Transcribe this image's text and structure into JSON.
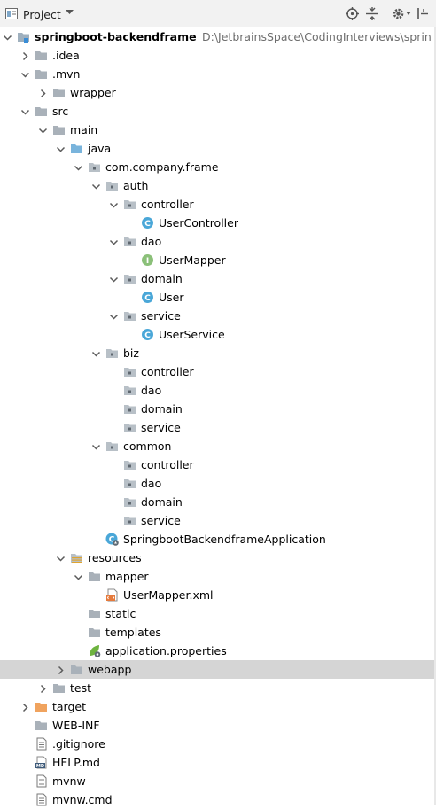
{
  "toolbar": {
    "title": "Project",
    "icons": [
      "project-view-icon",
      "dropdown-arrow-icon",
      "locate-icon",
      "collapse-all-icon",
      "gear-icon",
      "hide-panel-icon"
    ]
  },
  "tree": [
    {
      "label": "springboot-backendframe",
      "depth": 0,
      "state": "open",
      "icon": "module",
      "bold": true,
      "path": "D:\\JetbrainsSpace\\CodingInterviews\\springboot-b"
    },
    {
      "label": ".idea",
      "depth": 1,
      "state": "closed",
      "icon": "folder"
    },
    {
      "label": ".mvn",
      "depth": 1,
      "state": "open",
      "icon": "folder"
    },
    {
      "label": "wrapper",
      "depth": 2,
      "state": "closed",
      "icon": "folder"
    },
    {
      "label": "src",
      "depth": 1,
      "state": "open",
      "icon": "folder"
    },
    {
      "label": "main",
      "depth": 2,
      "state": "open",
      "icon": "folder"
    },
    {
      "label": "java",
      "depth": 3,
      "state": "open",
      "icon": "source-folder"
    },
    {
      "label": "com.company.frame",
      "depth": 4,
      "state": "open",
      "icon": "package"
    },
    {
      "label": "auth",
      "depth": 5,
      "state": "open",
      "icon": "package"
    },
    {
      "label": "controller",
      "depth": 6,
      "state": "open",
      "icon": "package"
    },
    {
      "label": "UserController",
      "depth": 7,
      "state": "leaf",
      "icon": "class"
    },
    {
      "label": "dao",
      "depth": 6,
      "state": "open",
      "icon": "package"
    },
    {
      "label": "UserMapper",
      "depth": 7,
      "state": "leaf",
      "icon": "interface"
    },
    {
      "label": "domain",
      "depth": 6,
      "state": "open",
      "icon": "package"
    },
    {
      "label": "User",
      "depth": 7,
      "state": "leaf",
      "icon": "class"
    },
    {
      "label": "service",
      "depth": 6,
      "state": "open",
      "icon": "package"
    },
    {
      "label": "UserService",
      "depth": 7,
      "state": "leaf",
      "icon": "class"
    },
    {
      "label": "biz",
      "depth": 5,
      "state": "open",
      "icon": "package"
    },
    {
      "label": "controller",
      "depth": 6,
      "state": "leaf",
      "icon": "package"
    },
    {
      "label": "dao",
      "depth": 6,
      "state": "leaf",
      "icon": "package"
    },
    {
      "label": "domain",
      "depth": 6,
      "state": "leaf",
      "icon": "package"
    },
    {
      "label": "service",
      "depth": 6,
      "state": "leaf",
      "icon": "package"
    },
    {
      "label": "common",
      "depth": 5,
      "state": "open",
      "icon": "package"
    },
    {
      "label": "controller",
      "depth": 6,
      "state": "leaf",
      "icon": "package"
    },
    {
      "label": "dao",
      "depth": 6,
      "state": "leaf",
      "icon": "package"
    },
    {
      "label": "domain",
      "depth": 6,
      "state": "leaf",
      "icon": "package"
    },
    {
      "label": "service",
      "depth": 6,
      "state": "leaf",
      "icon": "package"
    },
    {
      "label": "SpringbootBackendframeApplication",
      "depth": 5,
      "state": "leaf",
      "icon": "spring-app"
    },
    {
      "label": "resources",
      "depth": 3,
      "state": "open",
      "icon": "resources-folder"
    },
    {
      "label": "mapper",
      "depth": 4,
      "state": "open",
      "icon": "folder"
    },
    {
      "label": "UserMapper.xml",
      "depth": 5,
      "state": "leaf",
      "icon": "xml-file"
    },
    {
      "label": "static",
      "depth": 4,
      "state": "leaf",
      "icon": "folder"
    },
    {
      "label": "templates",
      "depth": 4,
      "state": "leaf",
      "icon": "folder"
    },
    {
      "label": "application.properties",
      "depth": 4,
      "state": "leaf",
      "icon": "spring-properties"
    },
    {
      "label": "webapp",
      "depth": 3,
      "state": "closed",
      "icon": "folder",
      "selected": true
    },
    {
      "label": "test",
      "depth": 2,
      "state": "closed",
      "icon": "folder"
    },
    {
      "label": "target",
      "depth": 1,
      "state": "closed",
      "icon": "excluded-folder"
    },
    {
      "label": "WEB-INF",
      "depth": 1,
      "state": "leaf",
      "icon": "folder"
    },
    {
      "label": ".gitignore",
      "depth": 1,
      "state": "leaf",
      "icon": "text-file"
    },
    {
      "label": "HELP.md",
      "depth": 1,
      "state": "leaf",
      "icon": "markdown-file"
    },
    {
      "label": "mvnw",
      "depth": 1,
      "state": "leaf",
      "icon": "text-file"
    },
    {
      "label": "mvnw.cmd",
      "depth": 1,
      "state": "leaf",
      "icon": "text-file"
    }
  ],
  "colors": {
    "folder": "#a9b1b9",
    "package_dot": "#8c959e",
    "source_folder": "#79b4dc",
    "excluded_folder": "#f0a35e",
    "class": "#4aa7d8",
    "interface": "#8bc079",
    "selection": "#d5d5d5",
    "chevron": "#5b5b5b"
  }
}
